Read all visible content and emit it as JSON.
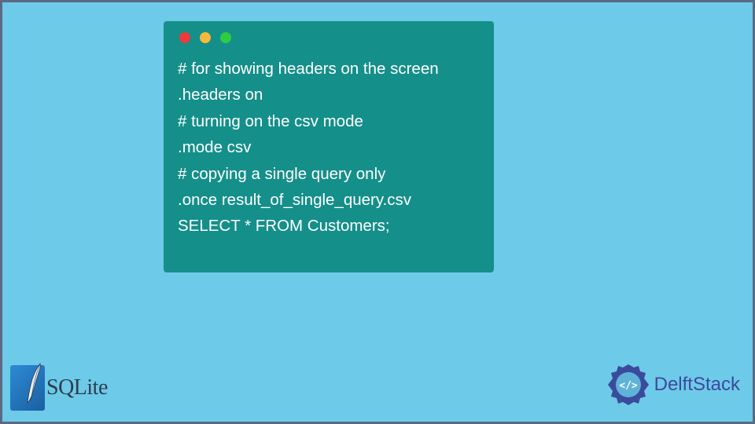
{
  "terminal": {
    "lines": [
      "# for showing headers on the screen",
      ".headers on",
      "# turning on the csv mode",
      ".mode csv",
      "# copying a single query only",
      ".once result_of_single_query.csv",
      "SELECT * FROM Customers;"
    ]
  },
  "logos": {
    "sqlite": "SQLite",
    "delftstack": "DelftStack"
  }
}
